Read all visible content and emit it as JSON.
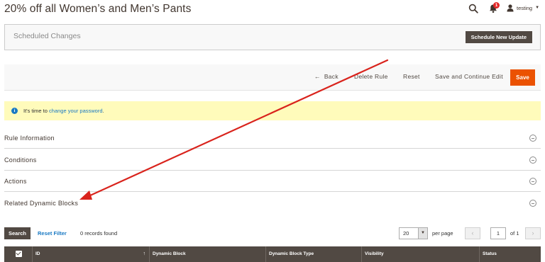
{
  "header": {
    "title": "20% off all Women’s and Men’s Pants",
    "notification_count": "1",
    "user_name": "testing"
  },
  "scheduled_changes": {
    "title": "Scheduled Changes",
    "button_label": "Schedule New Update"
  },
  "actions": {
    "back": "Back",
    "delete_rule": "Delete Rule",
    "reset": "Reset",
    "save_continue": "Save and Continue Edit",
    "save": "Save"
  },
  "message": {
    "prefix": "It's time to ",
    "link": "change your password",
    "suffix": "."
  },
  "sections": [
    {
      "title": "Rule Information"
    },
    {
      "title": "Conditions"
    },
    {
      "title": "Actions"
    },
    {
      "title": "Related Dynamic Blocks"
    }
  ],
  "grid": {
    "search_label": "Search",
    "reset_filter_label": "Reset Filter",
    "records_found": "0 records found",
    "per_page_value": "20",
    "per_page_label": "per page",
    "current_page": "1",
    "page_of": "of 1",
    "columns": [
      "ID",
      "Dynamic Block",
      "Dynamic Block Type",
      "Visibility",
      "Status"
    ]
  },
  "colors": {
    "accent": "#eb5202",
    "dark": "#514943",
    "link": "#1979c3",
    "annotation_arrow": "#d9231c"
  }
}
